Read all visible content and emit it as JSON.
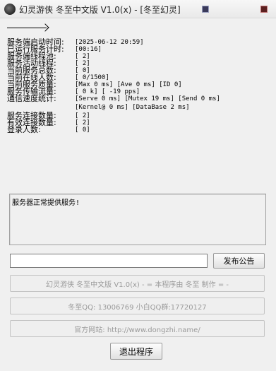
{
  "window": {
    "title": "幻灵游侠 冬至中文版 V1.0(x) - [冬至幻灵]",
    "icon": "app-icon",
    "controls": [
      "minimize-icon",
      "close-icon"
    ]
  },
  "stats": [
    {
      "key": "start_time",
      "label": "服务端启动时间:",
      "value": "[2025-06-12  20:59]"
    },
    {
      "key": "uptime",
      "label": "已运行服务计时:",
      "value": "[00:16]"
    },
    {
      "key": "thread_pool",
      "label": "服务端线程池:",
      "value": "[   2]"
    },
    {
      "key": "active_threads",
      "label": "服务活动线程:",
      "value": "[ 2]"
    },
    {
      "key": "total_services",
      "label": "当前服务总数:",
      "value": "[   0]"
    },
    {
      "key": "online",
      "label": "当前在线人数:",
      "value": "[  0/1500]"
    },
    {
      "key": "quality",
      "label": "当前服务质量:",
      "value": "[Max 0 ms] [Ave 0 ms] [ID 0]"
    },
    {
      "key": "transfer",
      "label": "服务传输流量:",
      "value": "[   0 k] [ -19 pps]"
    },
    {
      "key": "comm_speed",
      "label": "通信速度统计:",
      "value": "[Serve 0 ms] [Mutex 19 ms] [Send 0 ms]"
    },
    {
      "key": "comm_speed_2",
      "label": "",
      "value": "[Kernel@ 0 ms] [DataBase 2 ms]"
    },
    {
      "key": "connections",
      "label": "服务连接数量:",
      "value": "[  2]"
    },
    {
      "key": "valid_connections",
      "label": "有效连接数量:",
      "value": "[  2]"
    },
    {
      "key": "logins",
      "label": "登录人数:",
      "value": "[  0]"
    }
  ],
  "log": {
    "lines": [
      "服务器正常提供服务!"
    ]
  },
  "announce": {
    "input_value": "",
    "button_label": "发布公告"
  },
  "info_buttons": {
    "program": "幻灵游侠 冬至中文版 V1.0(x)  - = 本程序由 冬至 制作 = -",
    "qq": "冬至QQ: 13006769   小白QQ群:17720127",
    "website": "官方网站: http://www.dongzhi.name/"
  },
  "exit_button": {
    "label": "退出程序"
  }
}
